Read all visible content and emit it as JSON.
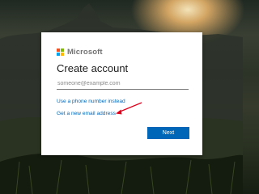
{
  "brand": {
    "name": "Microsoft",
    "logo_colors": [
      "#f25022",
      "#7fba00",
      "#00a4ef",
      "#ffb900"
    ]
  },
  "form": {
    "title": "Create account",
    "email_placeholder": "someone@example.com",
    "email_value": "",
    "phone_link": "Use a phone number instead",
    "new_email_link": "Get a new email address",
    "next_label": "Next"
  },
  "colors": {
    "accent": "#0067b8",
    "annotation": "#e0001b"
  }
}
